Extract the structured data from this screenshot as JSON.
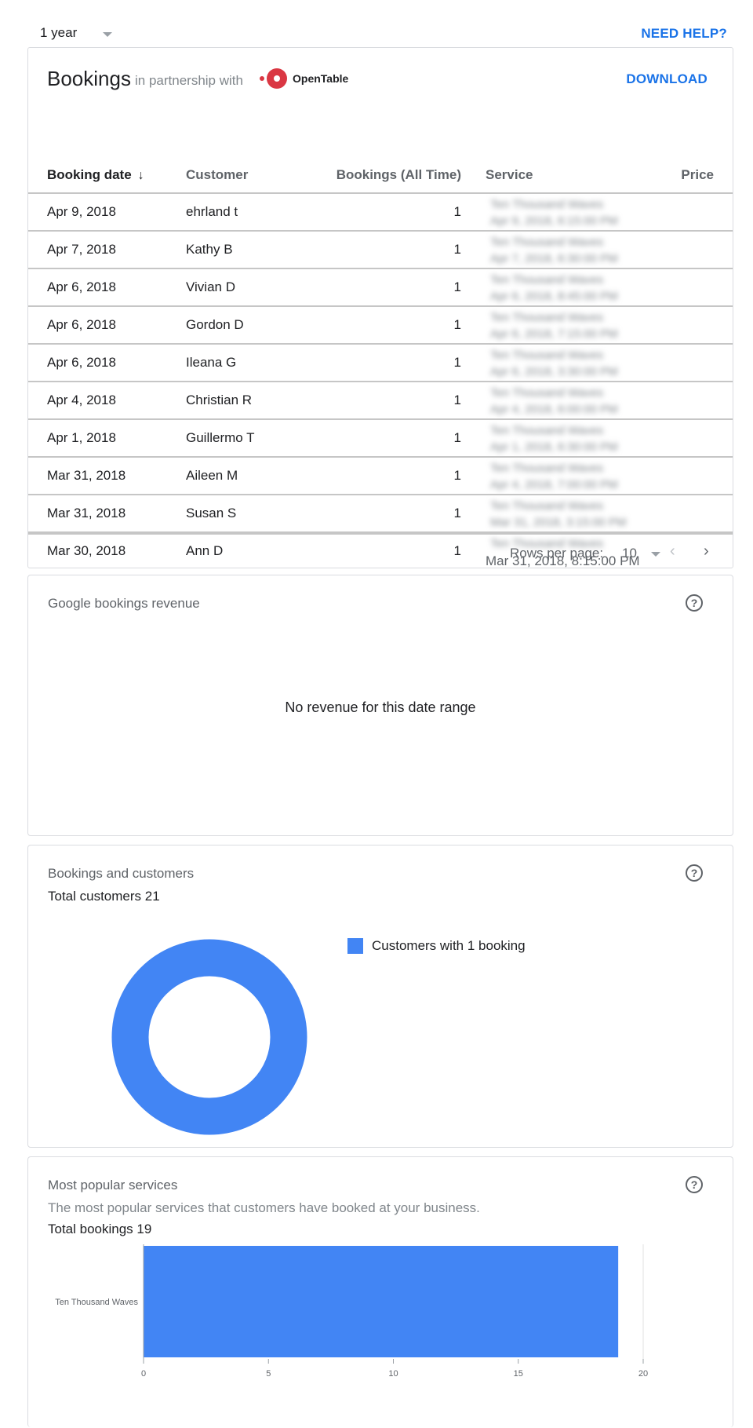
{
  "header": {
    "range_label": "1 year",
    "help_label": "NEED HELP?"
  },
  "bookings": {
    "title": "Bookings",
    "partner_text": "in partnership with",
    "partner_logo_text": "OpenTable",
    "download_label": "DOWNLOAD",
    "columns": [
      "Booking date",
      "Customer",
      "Bookings (All Time)",
      "Service",
      "Price"
    ],
    "sort_arrow": "↓",
    "rows": [
      {
        "date": "Apr 9, 2018",
        "customer": "ehrland t",
        "count": "1",
        "service": "Ten Thousand Waves",
        "time": "Apr 9, 2018, 6:15:00 PM"
      },
      {
        "date": "Apr 7, 2018",
        "customer": "Kathy B",
        "count": "1",
        "service": "Ten Thousand Waves",
        "time": "Apr 7, 2018, 6:30:00 PM"
      },
      {
        "date": "Apr 6, 2018",
        "customer": "Vivian D",
        "count": "1",
        "service": "Ten Thousand Waves",
        "time": "Apr 6, 2018, 8:45:00 PM"
      },
      {
        "date": "Apr 6, 2018",
        "customer": "Gordon D",
        "count": "1",
        "service": "Ten Thousand Waves",
        "time": "Apr 6, 2018, 7:15:00 PM"
      },
      {
        "date": "Apr 6, 2018",
        "customer": "Ileana G",
        "count": "1",
        "service": "Ten Thousand Waves",
        "time": "Apr 6, 2018, 3:30:00 PM"
      },
      {
        "date": "Apr 4, 2018",
        "customer": "Christian R",
        "count": "1",
        "service": "Ten Thousand Waves",
        "time": "Apr 4, 2018, 6:00:00 PM"
      },
      {
        "date": "Apr 1, 2018",
        "customer": "Guillermo T",
        "count": "1",
        "service": "Ten Thousand Waves",
        "time": "Apr 1, 2018, 6:30:00 PM"
      },
      {
        "date": "Mar 31, 2018",
        "customer": "Aileen M",
        "count": "1",
        "service": "Ten Thousand Waves",
        "time": "Apr 4, 2018, 7:00:00 PM"
      },
      {
        "date": "Mar 31, 2018",
        "customer": "Susan S",
        "count": "1",
        "service": "Ten Thousand Waves",
        "time": "Mar 31, 2018, 3:15:00 PM"
      },
      {
        "date": "Mar 30, 2018",
        "customer": "Ann D",
        "count": "1",
        "service": "Ten Thousand Waves",
        "time": "Mar 31, 2018, 8:15:00 PM"
      }
    ],
    "rows_per_page_label": "Rows per page:",
    "rows_per_page_value": "10"
  },
  "revenue": {
    "title": "Google bookings revenue",
    "empty_message": "No revenue for this date range"
  },
  "customers": {
    "title": "Bookings and customers",
    "total_line": "Total customers 21",
    "legend_label": "Customers with 1 booking"
  },
  "services": {
    "title": "Most popular services",
    "description": "The most popular services that customers have booked at your business.",
    "total_line": "Total bookings 19"
  },
  "colors": {
    "accent": "#1a73e8",
    "chart_blue": "#4285f4",
    "opentable_red": "#da3743"
  },
  "chart_data": [
    {
      "type": "pie",
      "subtype": "donut",
      "labels": [
        "Customers with 1 booking"
      ],
      "values": [
        21
      ],
      "legend": "right"
    },
    {
      "type": "bar",
      "orientation": "horizontal",
      "categories": [
        "Ten Thousand Waves"
      ],
      "values": [
        19
      ],
      "xlim": [
        0,
        20
      ],
      "xticks": [
        "0",
        "5",
        "10",
        "15",
        "20"
      ],
      "grid": true
    }
  ]
}
